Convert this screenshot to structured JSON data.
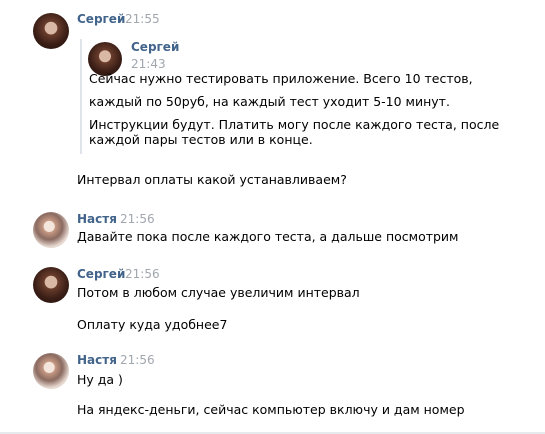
{
  "messages": [
    {
      "author": "Сергей",
      "time": "21:55"
    },
    {
      "forwarded": {
        "author": "Сергей",
        "time": "21:43",
        "lines": [
          "Сейчас нужно тестировать приложение. Всего 10 тестов,",
          "каждый по 50руб, на каждый тест уходит 5-10 минут.",
          "Инструкции будут. Платить могу после каждого теста, после",
          "каждой пары тестов или в конце."
        ]
      }
    },
    {
      "text": "Интервал оплаты какой устанавливаем?"
    },
    {
      "author": "Настя",
      "time": "21:56",
      "text": "Давайте пока после каждого теста, а дальше посмотрим"
    },
    {
      "author": "Сергей",
      "time": "21:56",
      "text": "Потом в любом случае увеличим интервал"
    },
    {
      "text": "Оплату куда удобнее7"
    },
    {
      "author": "Настя",
      "time": "21:56",
      "text": "Ну да )"
    },
    {
      "text": "На яндекс-деньги, сейчас компьютер включу и дам номер"
    }
  ]
}
